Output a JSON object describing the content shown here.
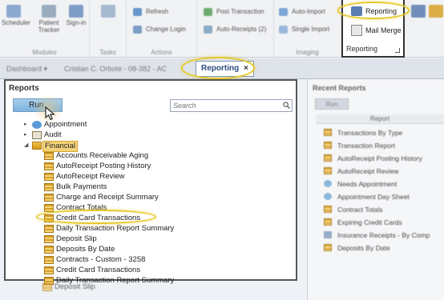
{
  "ribbon": {
    "groups": [
      {
        "label": "Modules",
        "buttons": [
          "Scheduler",
          "Patient\nTracker",
          "Sign-in"
        ]
      },
      {
        "label": "Tasks",
        "buttons": []
      },
      {
        "label": "Actions",
        "buttons": [
          "Refresh",
          "Change Login"
        ]
      },
      {
        "label": "",
        "buttons": [
          "Post Transaction",
          "Auto-Receipts (2)"
        ]
      },
      {
        "label": "Imaging",
        "buttons": [
          "Auto-Import",
          "Single Import"
        ]
      }
    ],
    "reporting_group": {
      "label": "Reporting",
      "reporting_button": "Reporting",
      "mail_merge_button": "Mail Merge"
    }
  },
  "tabs": {
    "dashboard": "Dashboard",
    "patient": "Cristian C. Orbote - 08-382 - AC",
    "active": "Reporting",
    "close": "×"
  },
  "left_panel": {
    "title": "Reports",
    "run_label": "Run",
    "search_placeholder": "Search",
    "tree": [
      {
        "label": "Appointment",
        "level": 0,
        "expand": "▸",
        "icon": "appointment-icon"
      },
      {
        "label": "Audit",
        "level": 0,
        "expand": "▸",
        "icon": "audit-icon"
      },
      {
        "label": "Financial",
        "level": 0,
        "expand": "◢",
        "icon": "folder-icon",
        "selected": true
      },
      {
        "label": "Accounts Receivable Aging",
        "level": 1
      },
      {
        "label": "AutoReceipt Posting History",
        "level": 1
      },
      {
        "label": "AutoReceipt Review",
        "level": 1
      },
      {
        "label": "Bulk Payments",
        "level": 1
      },
      {
        "label": "Charge and Receipt Summary",
        "level": 1
      },
      {
        "label": "Contract Totals",
        "level": 1
      },
      {
        "label": "Credit Card Transactions",
        "level": 1,
        "highlighted": true
      },
      {
        "label": "Daily Transaction Report Summary",
        "level": 1
      },
      {
        "label": "Deposit Slip",
        "level": 1
      },
      {
        "label": "Deposits By Date",
        "level": 1
      },
      {
        "label": "Contracts - Custom - 3258",
        "level": 1
      },
      {
        "label": "Credit Card Transactions",
        "level": 1
      },
      {
        "label": "Daily Transaction Report Summary",
        "level": 1
      },
      {
        "label": "Deposit Slip",
        "level": 1
      }
    ]
  },
  "right_panel": {
    "title": "Recent Reports",
    "run_label": "Run",
    "column": "Report",
    "items": [
      "Transactions By Type",
      "Transaction Report",
      "AutoReceipt Posting History",
      "AutoReceipt Review",
      "Needs Appointment",
      "Appointment Day Sheet",
      "Contract Totals",
      "Expiring Credit Cards",
      "Insurance Receipts - By Comp",
      "Deposits By Date"
    ]
  },
  "colors": {
    "highlight": "#e6c82a",
    "accent": "#2a4a80",
    "run_button": "#7db3de"
  }
}
